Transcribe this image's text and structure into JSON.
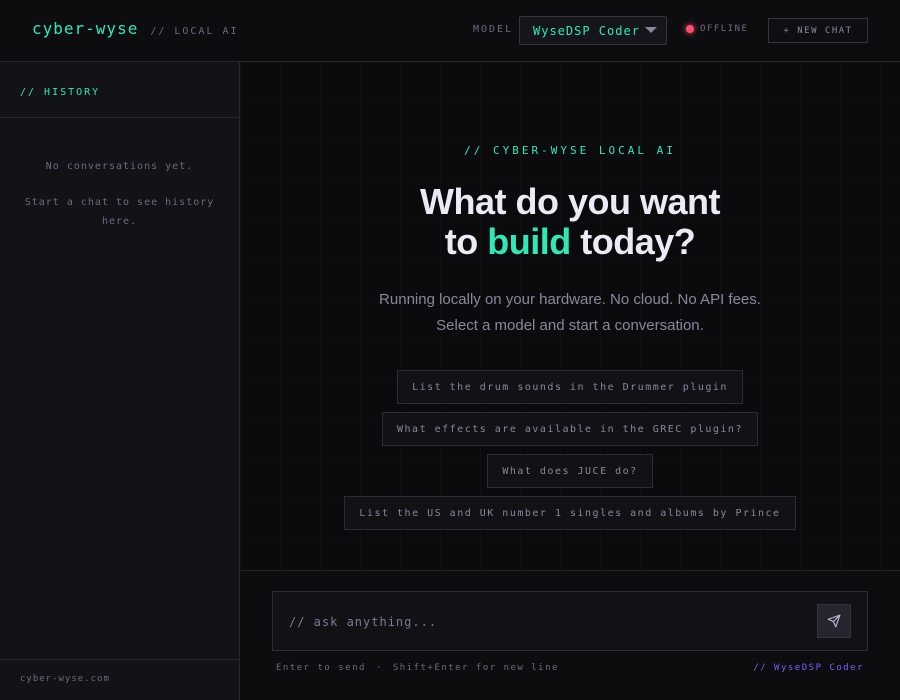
{
  "header": {
    "brand": "cyber-wyse",
    "brand_tag": "// LOCAL AI",
    "model_label": "MODEL",
    "model_selected": "WyseDSP Coder",
    "status": "OFFLINE",
    "status_color": "#ff4d6d",
    "new_chat": "+ NEW CHAT"
  },
  "sidebar": {
    "title": "// HISTORY",
    "empty_line1": "No conversations yet.",
    "empty_line2": "Start a chat to see history here.",
    "footer": "cyber-wyse.com"
  },
  "main": {
    "eyebrow": "// CYBER-WYSE LOCAL AI",
    "headline_line1": "What do you want",
    "headline_pre": "to ",
    "headline_accent": "build",
    "headline_post": " today?",
    "subtitle_line1": "Running locally on your hardware. No cloud. No API fees.",
    "subtitle_line2": "Select a model and start a conversation.",
    "suggestions": [
      "List the drum sounds in the Drummer plugin",
      "What effects are available in the GREC plugin?",
      "What does JUCE do?",
      "List the US and UK number 1 singles and albums by Prince"
    ]
  },
  "composer": {
    "placeholder": "// ask anything...",
    "send_icon": "send-icon",
    "hint_send": "Enter to send",
    "hint_separator": "·",
    "hint_newline": "Shift+Enter for new line",
    "active_model": "// WyseDSP Coder"
  },
  "colors": {
    "accent": "#2ee8b6",
    "secondary_accent": "#7b5cff",
    "background": "#0b0b0e"
  }
}
